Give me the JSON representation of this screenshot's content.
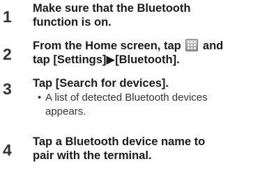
{
  "steps": [
    {
      "number": "1",
      "lines": [
        "Make sure that the Bluetooth",
        "function is on."
      ]
    },
    {
      "number": "2",
      "line1_before_icon": "From the Home screen, tap",
      "icon": "app-launcher-grid-icon",
      "line1_after_icon": "and",
      "line2": "tap [Settings]▶[Bluetooth]."
    },
    {
      "number": "3",
      "lines": [
        "Tap [Search for devices]."
      ],
      "sub_bullet": "•",
      "sub_lines": [
        "A list of detected Bluetooth devices",
        "appears."
      ]
    },
    {
      "number": "4",
      "lines": [
        "Tap a Bluetooth device name to",
        "pair with the terminal."
      ]
    }
  ]
}
